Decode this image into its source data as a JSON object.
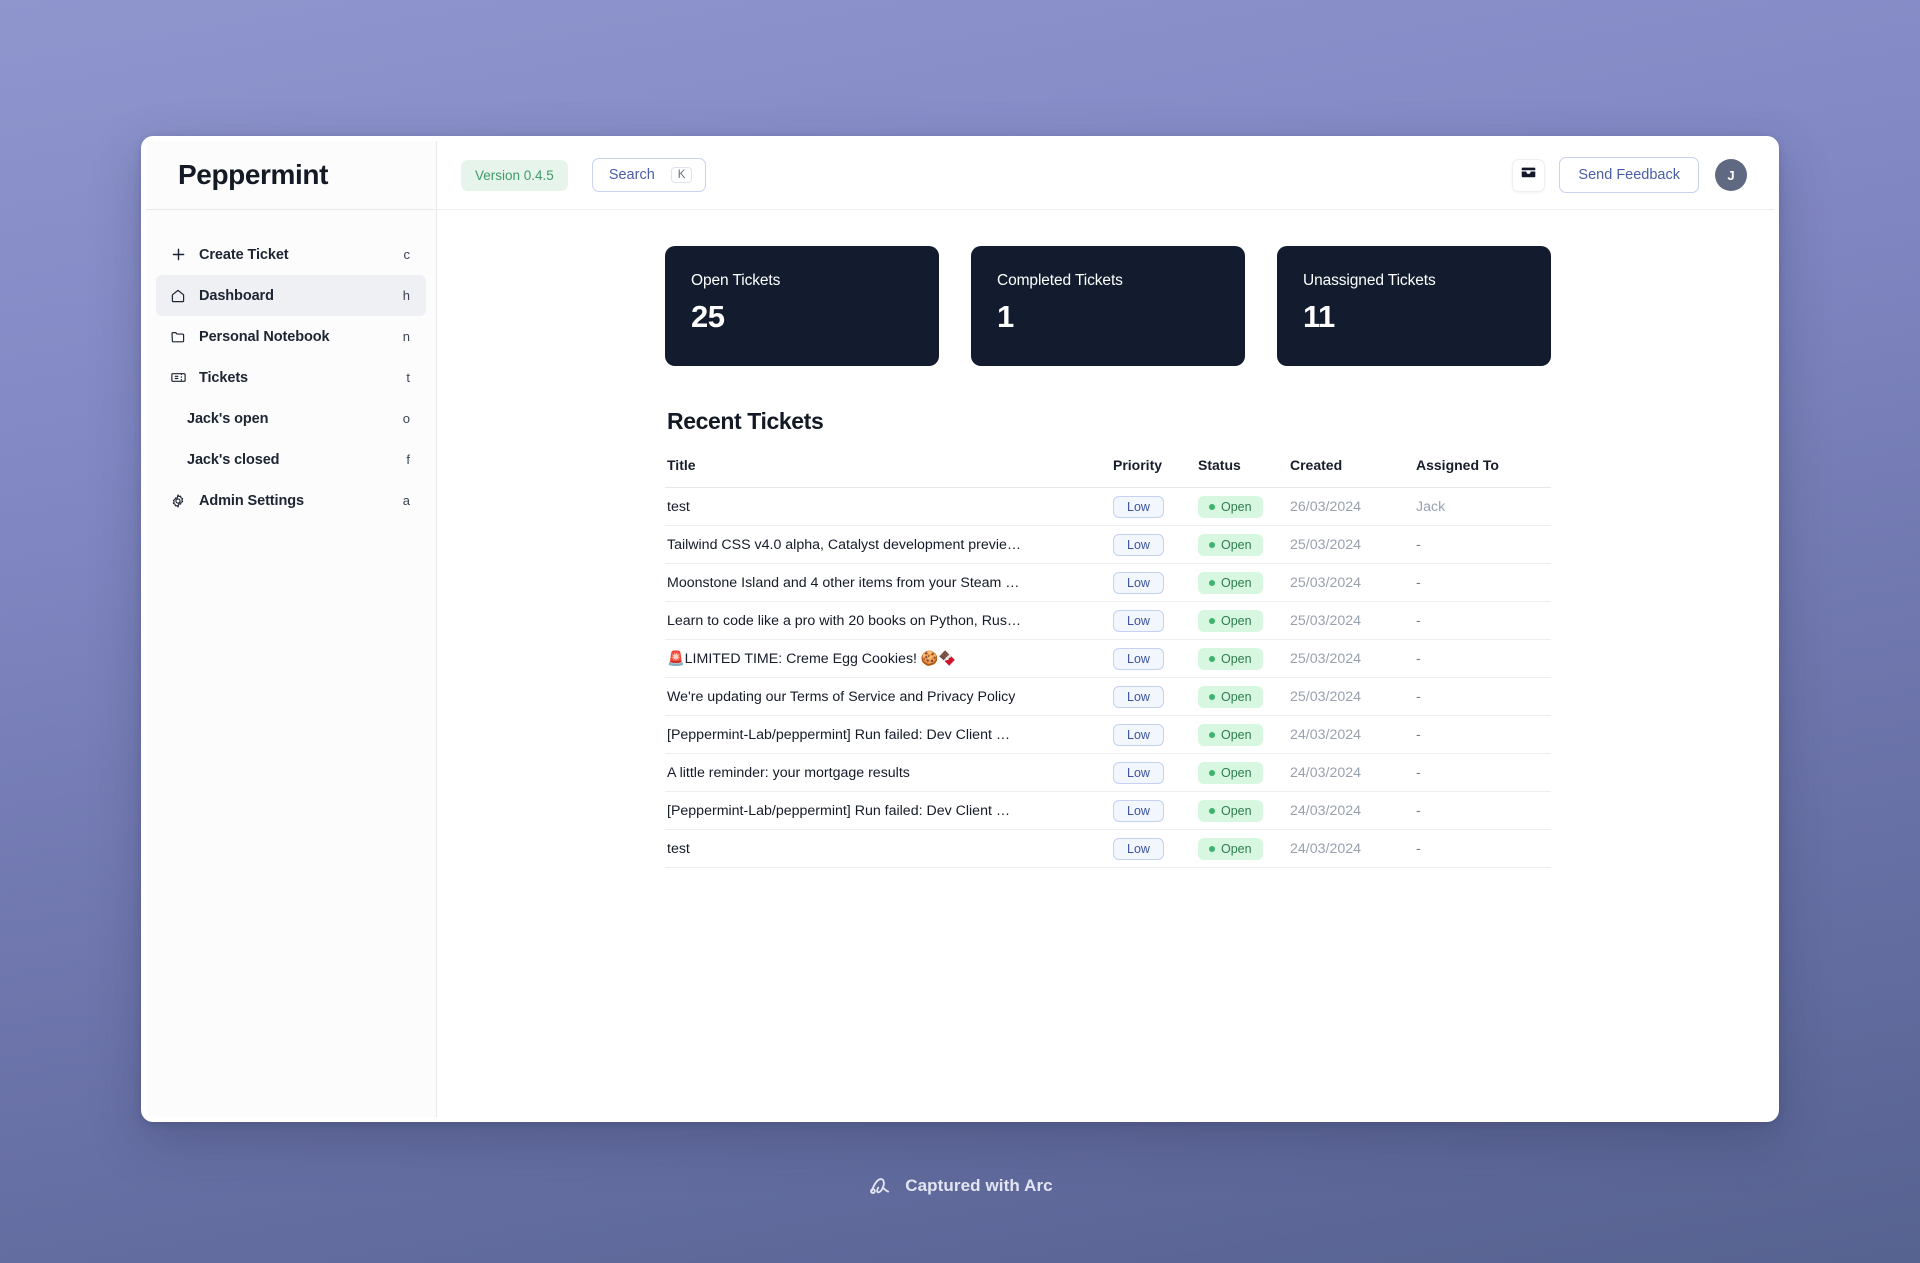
{
  "background": {
    "top_color": "#8f95cd",
    "bottom_color": "#566290"
  },
  "sidebar": {
    "brand": "Peppermint",
    "items": [
      {
        "label": "Create Ticket",
        "key": "c",
        "icon": "plus-icon",
        "active": false,
        "sub": false
      },
      {
        "label": "Dashboard",
        "key": "h",
        "icon": "home-icon",
        "active": true,
        "sub": false
      },
      {
        "label": "Personal Notebook",
        "key": "n",
        "icon": "folder-icon",
        "active": false,
        "sub": false
      },
      {
        "label": "Tickets",
        "key": "t",
        "icon": "ticket-icon",
        "active": false,
        "sub": false
      },
      {
        "label": "Jack's open",
        "key": "o",
        "icon": "",
        "active": false,
        "sub": true
      },
      {
        "label": "Jack's closed",
        "key": "f",
        "icon": "",
        "active": false,
        "sub": true
      },
      {
        "label": "Admin Settings",
        "key": "a",
        "icon": "gear-icon",
        "active": false,
        "sub": false
      }
    ]
  },
  "topbar": {
    "version": "Version 0.4.5",
    "version_color": "#3f9a66",
    "search_label": "Search",
    "search_key": "K",
    "inbox_icon": "inbox-icon",
    "feedback_label": "Send Feedback",
    "avatar_initial": "J"
  },
  "stats": [
    {
      "label": "Open Tickets",
      "value": "25"
    },
    {
      "label": "Completed Tickets",
      "value": "1"
    },
    {
      "label": "Unassigned Tickets",
      "value": "11"
    }
  ],
  "tickets_section": {
    "title": "Recent Tickets",
    "columns": [
      "Title",
      "Priority",
      "Status",
      "Created",
      "Assigned To"
    ],
    "rows": [
      {
        "title": "test",
        "priority": "Low",
        "status": "Open",
        "created": "26/03/2024",
        "assigned": "Jack"
      },
      {
        "title": "Tailwind CSS v4.0 alpha, Catalyst development previe…",
        "priority": "Low",
        "status": "Open",
        "created": "25/03/2024",
        "assigned": "-"
      },
      {
        "title": "Moonstone Island and 4 other items from your Steam …",
        "priority": "Low",
        "status": "Open",
        "created": "25/03/2024",
        "assigned": "-"
      },
      {
        "title": "Learn to code like a pro with 20 books on Python, Rus…",
        "priority": "Low",
        "status": "Open",
        "created": "25/03/2024",
        "assigned": "-"
      },
      {
        "title": "🚨LIMITED TIME: Creme Egg Cookies! 🍪🍫",
        "priority": "Low",
        "status": "Open",
        "created": "25/03/2024",
        "assigned": "-"
      },
      {
        "title": "We're updating our Terms of Service and Privacy Policy",
        "priority": "Low",
        "status": "Open",
        "created": "25/03/2024",
        "assigned": "-"
      },
      {
        "title": "[Peppermint-Lab/peppermint] Run failed: Dev Client …",
        "priority": "Low",
        "status": "Open",
        "created": "24/03/2024",
        "assigned": "-"
      },
      {
        "title": "A little reminder: your mortgage results",
        "priority": "Low",
        "status": "Open",
        "created": "24/03/2024",
        "assigned": "-"
      },
      {
        "title": "[Peppermint-Lab/peppermint] Run failed: Dev Client …",
        "priority": "Low",
        "status": "Open",
        "created": "24/03/2024",
        "assigned": "-"
      },
      {
        "title": "test",
        "priority": "Low",
        "status": "Open",
        "created": "24/03/2024",
        "assigned": "-"
      }
    ]
  },
  "watermark": {
    "text": "Captured with Arc",
    "icon": "arc-logo-icon"
  }
}
